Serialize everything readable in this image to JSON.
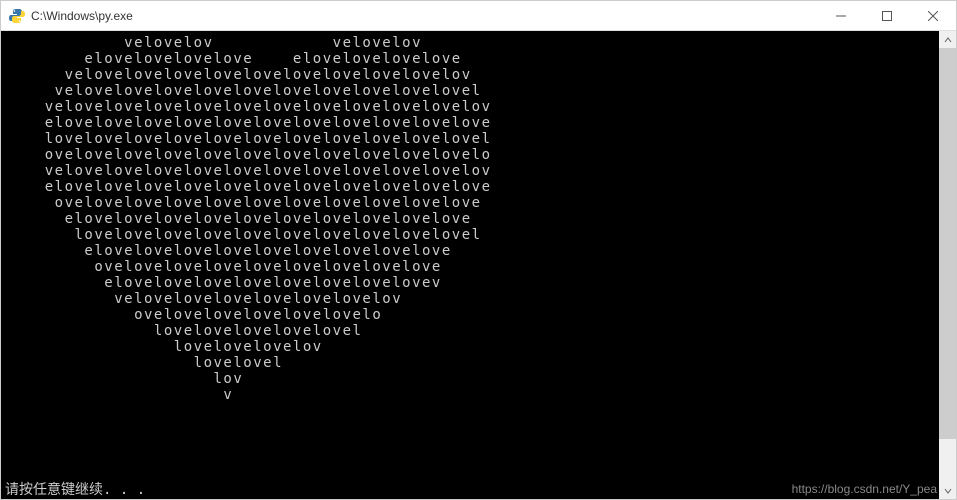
{
  "window": {
    "title": "C:\\Windows\\py.exe"
  },
  "console": {
    "lines": [
      "            velovelov            velovelov",
      "        elovelovelovelove    elovelovelovelove",
      "      velovelovelovelovelovelovelovelovelovelov",
      "     velovelovelovelovelovelovelovelovelovelovel",
      "    velovelovelovelovelovelovelovelovelovelovelov",
      "    elovelovelovelovelovelovelovelovelovelovelove",
      "    lovelovelovelovelovelovelovelovelovelovelovel",
      "    ovelovelovelovelovelovelovelovelovelovelovelo",
      "    velovelovelovelovelovelovelovelovelovelovelov",
      "    elovelovelovelovelovelovelovelovelovelovelove",
      "     ovelovelovelovelovelovelovelovelovelovelove",
      "      elovelovelovelovelovelovelovelovelovelove",
      "       lovelovelovelovelovelovelovelovelovelovel",
      "        elovelovelovelovelovelovelovelovelove",
      "         ovelovelovelovelovelovelovelovelove",
      "          elovelovelovelovelovelovelovelovev",
      "           velovelovelovelovelovelovelov",
      "             ovelovelovelovelovelovelo",
      "               lovelovelovelovelovel",
      "                 lovelovelovelov",
      "                   lovelovel",
      "                     lov",
      "                      v"
    ],
    "prompt": "请按任意键继续. . ."
  },
  "watermark": "https://blog.csdn.net/Y_pea"
}
